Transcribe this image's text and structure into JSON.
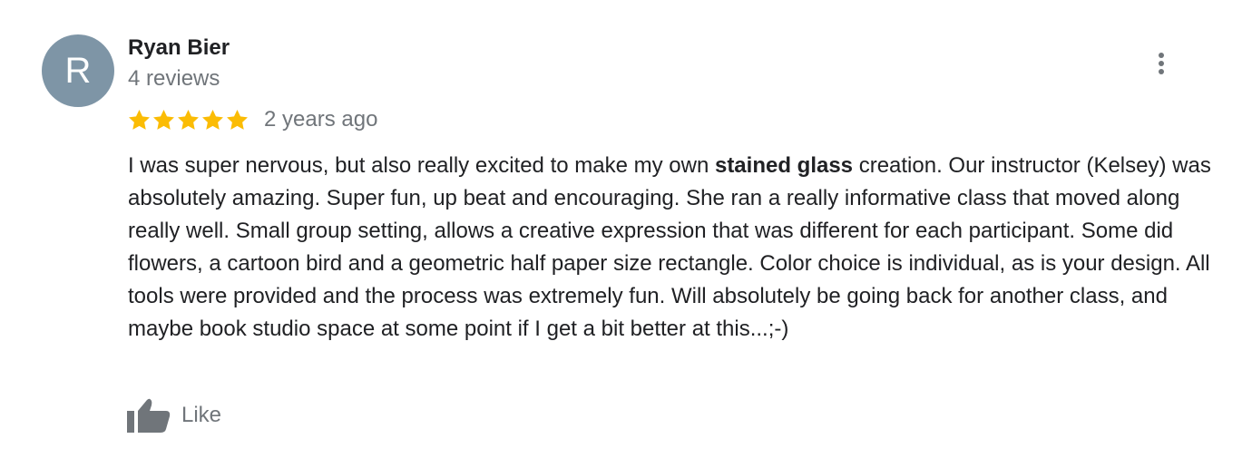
{
  "reviewer": {
    "initial": "R",
    "name": "Ryan Bier",
    "review_count": "4 reviews",
    "avatar_color": "#7e95a6"
  },
  "rating": {
    "stars": 5,
    "max_stars": 5,
    "star_color": "#fbbc04"
  },
  "review": {
    "date": "2 years ago",
    "text_before": "I was super nervous, but also really excited to make my own ",
    "text_bold": "stained glass",
    "text_after": " creation. Our instructor (Kelsey) was absolutely amazing. Super fun, up beat and encouraging. She ran a really informative class that moved along really well. Small group setting, allows a creative expression that was different for each participant. Some did flowers, a cartoon bird and a geometric half paper size rectangle. Color choice is individual, as is your design. All tools were provided and the process was extremely fun. Will absolutely be going back for another class, and maybe book studio space at some point if I get a bit better at this...;-)"
  },
  "actions": {
    "like_label": "Like",
    "like_icon": "thumbs-up-icon",
    "more_icon": "more-vert-icon"
  }
}
